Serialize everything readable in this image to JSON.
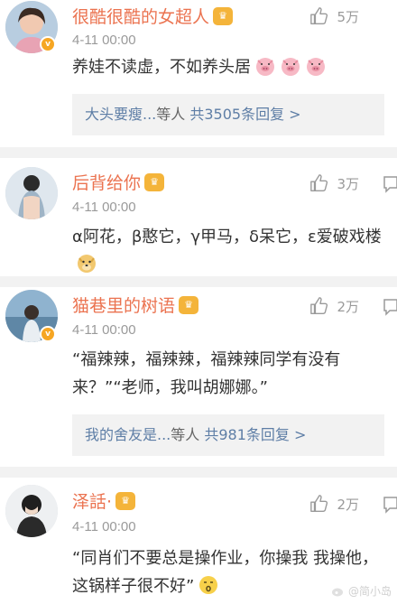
{
  "comments": [
    {
      "name": "很酷很酷的女超人",
      "time": "4-11 00:00",
      "likes": "5万",
      "text": "养娃不读虚，不如养头居",
      "emoji": "pig-emoji",
      "replies": {
        "who": "大头要瘦...",
        "mid": "等人 ",
        "count": "共3505条回复 >"
      }
    },
    {
      "name": "后背给你",
      "time": "4-11 00:00",
      "likes": "3万",
      "text": "α阿花，β憨它，γ甲马，δ呆它，ε爱破戏楼",
      "emoji": "doge-emoji"
    },
    {
      "name": "猫巷里的树语",
      "time": "4-11 00:00",
      "likes": "2万",
      "text": "“福辣辣，福辣辣，福辣辣同学有没有来？”“老师，我叫胡娜娜。”",
      "replies": {
        "who": "我的舍友是...",
        "mid": "等人 ",
        "count": "共981条回复 >"
      }
    },
    {
      "name": "泽話·",
      "time": "4-11 00:00",
      "likes": "2万",
      "text": "“同肖们不要总是操作业，你操我 我操他，这锅样子很不好”",
      "emoji": "smirk-emoji"
    }
  ],
  "colors": {
    "name": "#eb7350",
    "link": "#5e7ea6",
    "time": "#9a9a9a",
    "bg_gray": "#f2f2f2"
  },
  "watermark": "@简小岛"
}
